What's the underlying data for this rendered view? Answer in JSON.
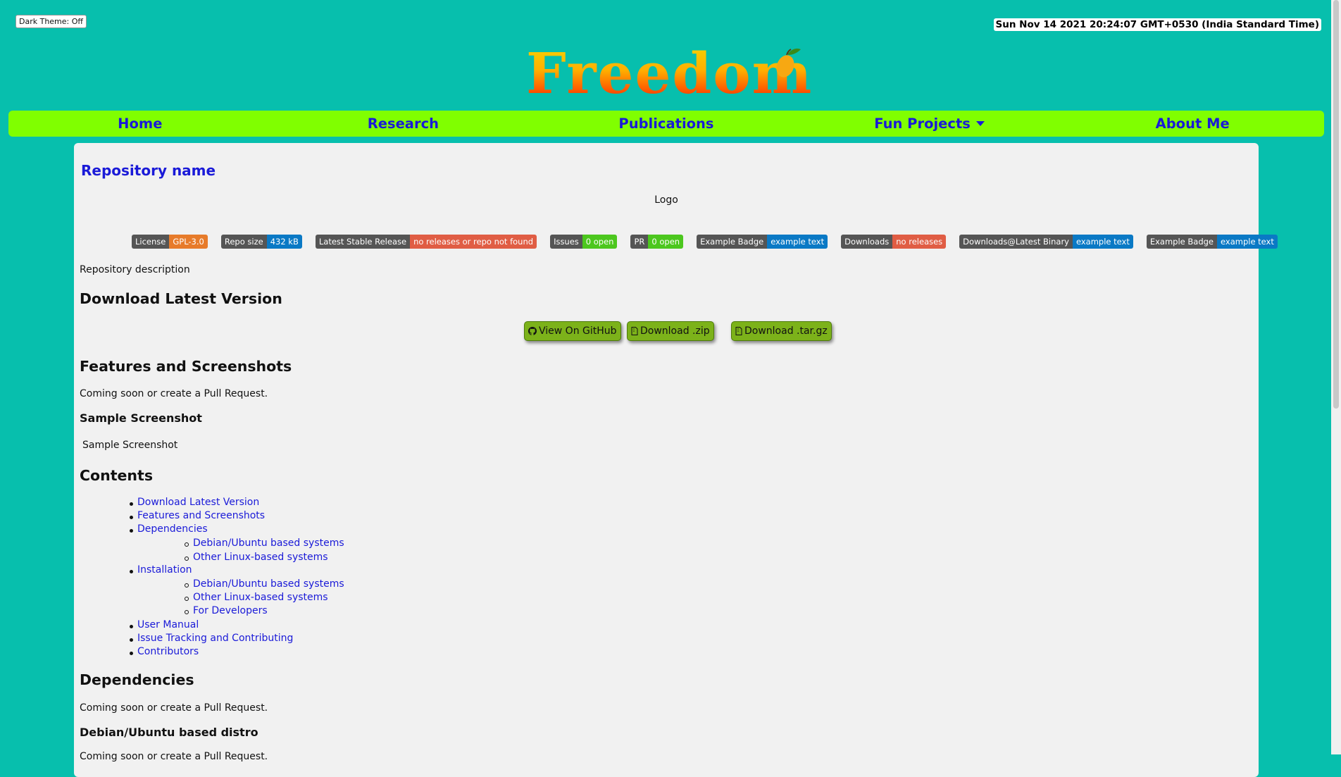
{
  "theme_toggle": "Dark Theme: Off",
  "clock": "Sun Nov 14 2021 20:24:07 GMT+0530 (India Standard Time)",
  "site_logo": "Freedom",
  "nav": {
    "home": "Home",
    "research": "Research",
    "publications": "Publications",
    "fun_projects": "Fun Projects",
    "about": "About Me"
  },
  "repo": {
    "title": "Repository name",
    "logo_alt": "Logo",
    "description": "Repository description"
  },
  "badges": [
    {
      "label": "License",
      "value": "GPL-3.0",
      "color": "#e77b2a"
    },
    {
      "label": "Repo size",
      "value": "432 kB",
      "color": "#0a79c5"
    },
    {
      "label": "Latest Stable Release",
      "value": "no releases or repo not found",
      "color": "#e05d44"
    },
    {
      "label": "Issues",
      "value": "0 open",
      "color": "#4cc71e"
    },
    {
      "label": "PR",
      "value": "0 open",
      "color": "#4cc71e"
    },
    {
      "label": "Example Badge",
      "value": "example text",
      "color": "#0a79c5"
    },
    {
      "label": "Downloads",
      "value": "no releases",
      "color": "#e05d44"
    },
    {
      "label": "Downloads@Latest Binary",
      "value": "example text",
      "color": "#0a79c5"
    },
    {
      "label": "Example Badge",
      "value": "example text",
      "color": "#0a79c5"
    }
  ],
  "sections": {
    "download_heading": "Download Latest Version",
    "buttons": {
      "github": "View On GitHub",
      "zip": "Download .zip",
      "targz": "Download .tar.gz"
    },
    "features_heading": "Features and Screenshots",
    "features_text": "Coming soon or create a Pull Request.",
    "sample_heading": "Sample Screenshot",
    "sample_alt": "Sample Screenshot",
    "contents_heading": "Contents",
    "dependencies_heading": "Dependencies",
    "dependencies_text": "Coming soon or create a Pull Request.",
    "debian_heading": "Debian/Ubuntu based distro",
    "debian_text": "Coming soon or create a Pull Request."
  },
  "toc": {
    "download": "Download Latest Version",
    "features": "Features and Screenshots",
    "dependencies": "Dependencies",
    "dep_debian": "Debian/Ubuntu based systems",
    "dep_other": "Other Linux-based systems",
    "installation": "Installation",
    "inst_debian": "Debian/Ubuntu based systems",
    "inst_other": "Other Linux-based systems",
    "inst_dev": "For Developers",
    "manual": "User Manual",
    "issues": "Issue Tracking and Contributing",
    "contributors": "Contributors"
  },
  "colors": {
    "page_bg": "#07bfad",
    "nav_bg": "#80ff00",
    "link": "#1a1ad8",
    "button_green": "#7cb21a"
  }
}
